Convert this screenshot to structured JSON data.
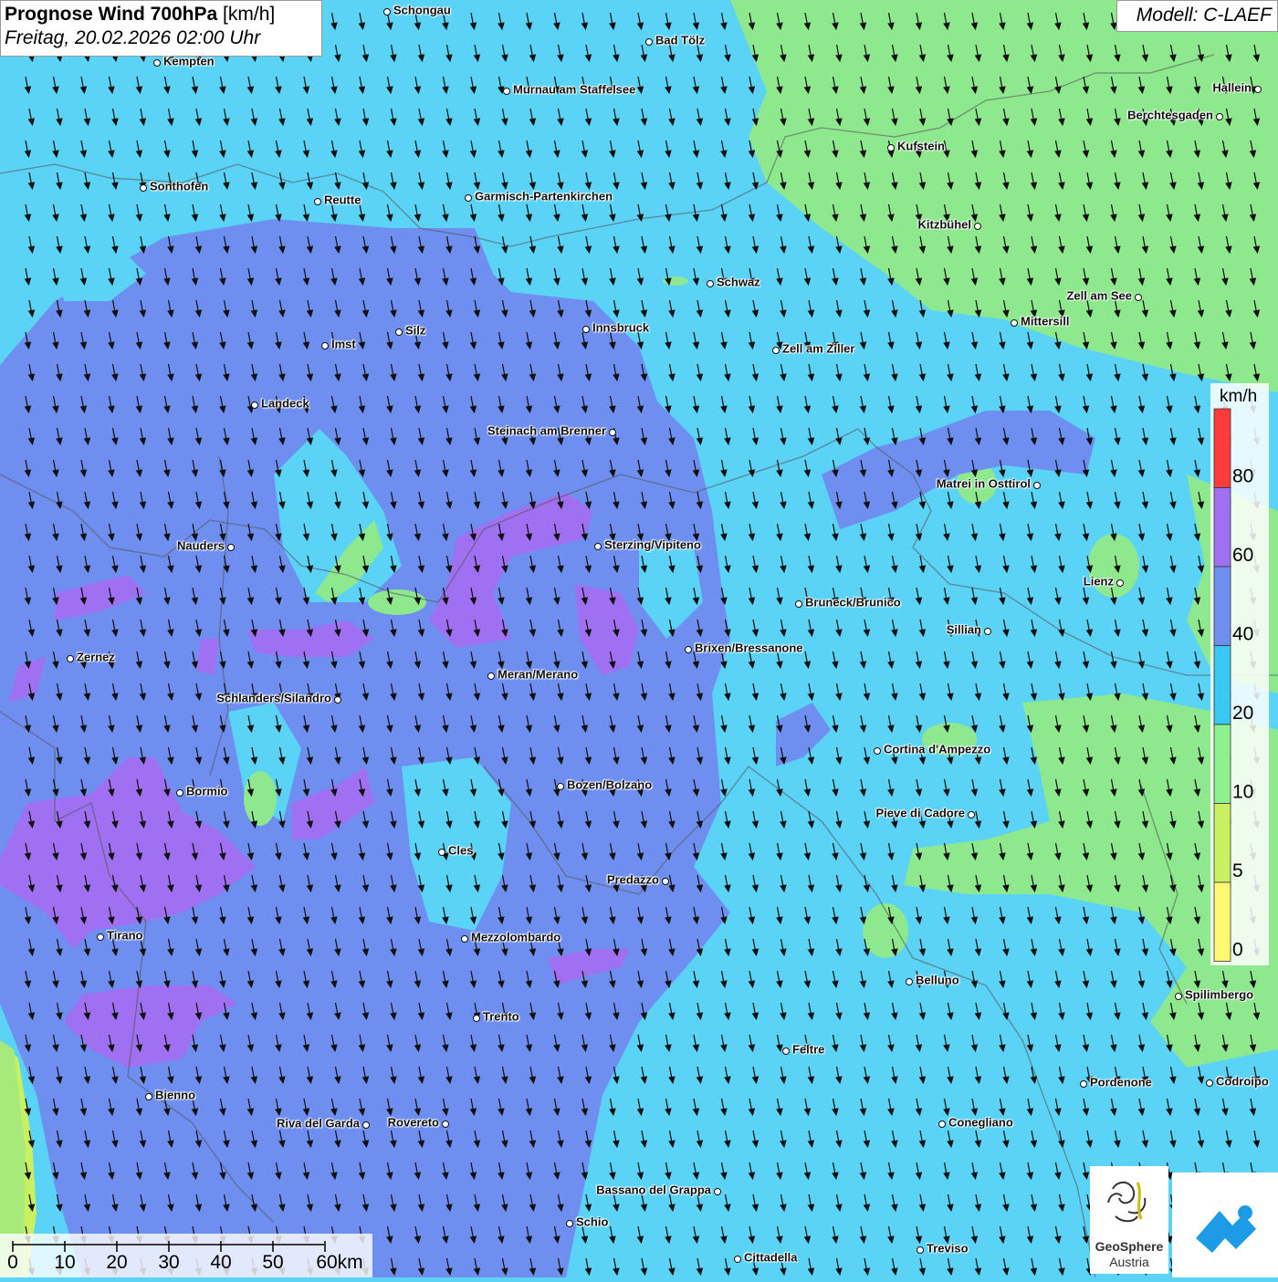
{
  "title": {
    "main": "Prognose Wind 700hPa",
    "unit": "[km/h]",
    "datetime": "Freitag, 20.02.2026 02:00 Uhr"
  },
  "model": "Modell: C-LAEF",
  "legend": {
    "unit": "km/h",
    "ticks": [
      "80",
      "60",
      "40",
      "20",
      "10",
      "5",
      "0"
    ],
    "colors": [
      "#ff3b3b",
      "#a070f2",
      "#6f8ff0",
      "#38c8f2",
      "#8ff08f",
      "#c8f060",
      "#fff870"
    ]
  },
  "scalebar": {
    "labels": [
      "0",
      "10",
      "20",
      "30",
      "40",
      "50",
      "60km"
    ]
  },
  "wind_direction": "north-north-west to south-south-east",
  "logos": {
    "geosphere_line1": "GeoSphere",
    "geosphere_line2": "Austria"
  },
  "cities": [
    {
      "name": "Schongau"
    },
    {
      "name": "Bad Tölz"
    },
    {
      "name": "Kempten"
    },
    {
      "name": "Murnau am Staffelsee"
    },
    {
      "name": "Hallein"
    },
    {
      "name": "Berchtesgaden"
    },
    {
      "name": "Kufstein"
    },
    {
      "name": "Sonthofen"
    },
    {
      "name": "Reutte"
    },
    {
      "name": "Garmisch-Partenkirchen"
    },
    {
      "name": "Kitzbühel"
    },
    {
      "name": "Schwaz"
    },
    {
      "name": "Zell am See"
    },
    {
      "name": "Mittersill"
    },
    {
      "name": "Innsbruck"
    },
    {
      "name": "Silz"
    },
    {
      "name": "Imst"
    },
    {
      "name": "Zell am Ziller"
    },
    {
      "name": "Landeck"
    },
    {
      "name": "Steinach am Brenner"
    },
    {
      "name": "Matrei in Osttirol"
    },
    {
      "name": "Nauders"
    },
    {
      "name": "Sterzing/Vipiteno"
    },
    {
      "name": "Lienz"
    },
    {
      "name": "Bruneck/Brunico"
    },
    {
      "name": "Sillian"
    },
    {
      "name": "Zernez"
    },
    {
      "name": "Brixen/Bressanone"
    },
    {
      "name": "Meran/Merano"
    },
    {
      "name": "Schlanders/Silandro"
    },
    {
      "name": "Cortina d'Ampezzo"
    },
    {
      "name": "Bozen/Bolzano"
    },
    {
      "name": "Bormio"
    },
    {
      "name": "Pieve di Cadore"
    },
    {
      "name": "Cles"
    },
    {
      "name": "Predazzo"
    },
    {
      "name": "Tirano"
    },
    {
      "name": "Mezzolombardo"
    },
    {
      "name": "Belluno"
    },
    {
      "name": "Spilimbergo"
    },
    {
      "name": "Trento"
    },
    {
      "name": "Feltre"
    },
    {
      "name": "Pordenone"
    },
    {
      "name": "Codroipo"
    },
    {
      "name": "Bienno"
    },
    {
      "name": "Riva del Garda"
    },
    {
      "name": "Rovereto"
    },
    {
      "name": "Conegliano"
    },
    {
      "name": "Bassano del Grappa"
    },
    {
      "name": "Schio"
    },
    {
      "name": "Treviso"
    },
    {
      "name": "Cittadella"
    }
  ]
}
